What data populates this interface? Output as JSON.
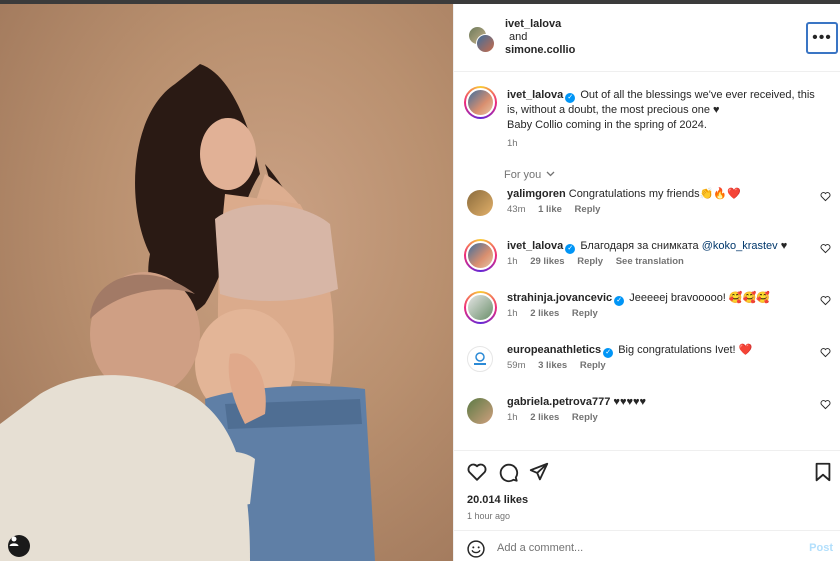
{
  "header": {
    "user1": "ivet_lalova",
    "and_text": "and",
    "user2": "simone.collio",
    "more_label": "•••"
  },
  "caption": {
    "username": "ivet_lalova",
    "text": "Out of all the blessings we've ever received, this is, without a doubt, the most precious one ♥",
    "line2": "Baby Collio coming in the spring of 2024.",
    "time": "1h"
  },
  "for_you": "For you",
  "comments": [
    {
      "username": "yalimgoren",
      "text": "Congratulations my friends👏🔥❤️",
      "time": "43m",
      "likes": "1 like",
      "reply": "Reply",
      "extra": "",
      "verified": false
    },
    {
      "username": "ivet_lalova",
      "text": "Благодаря за снимката",
      "mention": "@koko_krastev",
      "suffix": " ♥",
      "time": "1h",
      "likes": "29 likes",
      "reply": "Reply",
      "extra": "See translation",
      "verified": true
    },
    {
      "username": "strahinja.jovancevic",
      "text": "Jeeeeej bravooooo! 🥰🥰🥰",
      "time": "1h",
      "likes": "2 likes",
      "reply": "Reply",
      "extra": "",
      "verified": true
    },
    {
      "username": "europeanathletics",
      "text": "Big congratulations Ivet! ❤️",
      "time": "59m",
      "likes": "3 likes",
      "reply": "Reply",
      "extra": "",
      "verified": true
    },
    {
      "username": "gabriela.petrova777",
      "text": "♥♥♥♥♥",
      "time": "1h",
      "likes": "2 likes",
      "reply": "Reply",
      "extra": "",
      "verified": false
    }
  ],
  "actions": {
    "likes": "20.014 likes",
    "time": "1 hour ago"
  },
  "add_comment": {
    "placeholder": "Add a comment...",
    "post_label": "Post"
  }
}
